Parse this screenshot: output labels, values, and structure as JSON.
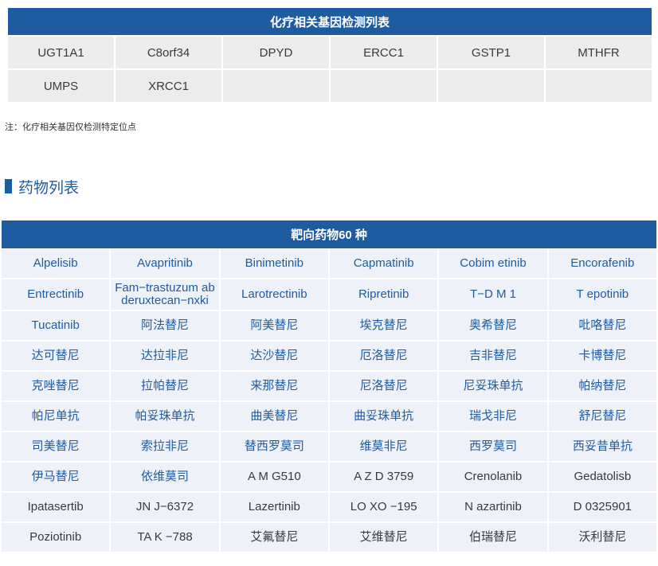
{
  "gene_table": {
    "title": "化疗相关基因检测列表",
    "cells": [
      "UGT1A1",
      "C8orf34",
      "DPYD",
      "ERCC1",
      "GSTP1",
      "MTHFR",
      "UMPS",
      "XRCC1",
      "",
      "",
      "",
      ""
    ]
  },
  "note": "注：化疗相关基因仅检测特定位点",
  "section_title": "药物列表",
  "drug_table": {
    "title": "靶向药物60 种",
    "rows": [
      [
        "Alpelisib",
        "Avapritinib",
        "Binimetinib",
        "Capmatinib",
        "Cobim etinib",
        "Encorafenib"
      ],
      [
        "Entrectinib",
        "Fam−trastuzum ab deruxtecan−nxki",
        "Larotrectinib",
        "Ripretinib",
        "T−D M 1",
        "T epotinib"
      ],
      [
        "Tucatinib",
        "阿法替尼",
        "阿美替尼",
        "埃克替尼",
        "奥希替尼",
        "吡咯替尼"
      ],
      [
        "达可替尼",
        "达拉非尼",
        "达沙替尼",
        "厄洛替尼",
        "吉非替尼",
        "卡博替尼"
      ],
      [
        "克唑替尼",
        "拉帕替尼",
        "来那替尼",
        "尼洛替尼",
        "尼妥珠单抗",
        "帕纳替尼"
      ],
      [
        "帕尼单抗",
        "帕妥珠单抗",
        "曲美替尼",
        "曲妥珠单抗",
        "瑞戈非尼",
        "舒尼替尼"
      ],
      [
        "司美替尼",
        "索拉非尼",
        "替西罗莫司",
        "维莫非尼",
        "西罗莫司",
        "西妥昔单抗"
      ],
      [
        "伊马替尼",
        "依维莫司",
        "A M G510",
        "A Z D 3759",
        "Crenolanib",
        "Gedatolisb"
      ],
      [
        "Ipatasertib",
        "JN J−6372",
        "Lazertinib",
        "LO XO −195",
        "N azartinib",
        "D 0325901"
      ],
      [
        "Poziotinib",
        "TA K −788",
        "艾氟替尼",
        "艾维替尼",
        "伯瑞替尼",
        "沃利替尼"
      ]
    ],
    "row_colors": [
      "blue",
      "blue",
      "blue",
      "blue",
      "blue",
      "blue",
      "blue",
      "mixed",
      "dark",
      "dark"
    ],
    "colors": {
      "header_bg": "#1f5ba0",
      "cell_bg": "#eef2f8",
      "blue_text": "#1f5ba0",
      "dark_text": "#3a3a3a"
    }
  }
}
